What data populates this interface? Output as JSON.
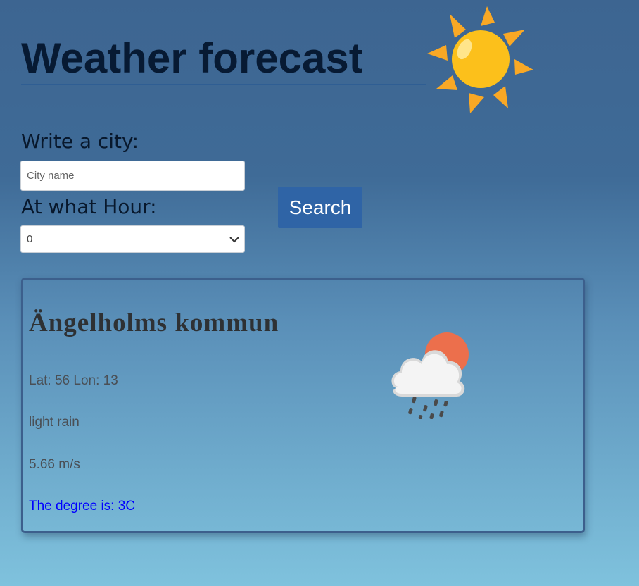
{
  "header": {
    "title": "Weather forecast",
    "logo_icon": "sun-icon"
  },
  "form": {
    "city_label": "Write a city:",
    "city_placeholder": "City name",
    "city_value": "",
    "hour_label": "At what Hour:",
    "hour_selected": "0",
    "search_label": "Search"
  },
  "result": {
    "city": "Ängelholms kommun",
    "coords": "Lat: 56 Lon: 13",
    "description": "light rain",
    "wind": "5.66 m/s",
    "degree": "The degree is: 3C",
    "weather_icon": "light-rain-cloud-sun-icon"
  },
  "colors": {
    "title": "#071a33",
    "button": "#2f64a6",
    "degree_text": "#0000ff",
    "sun": "#fcc01b",
    "sun_rays": "#f9a825"
  }
}
